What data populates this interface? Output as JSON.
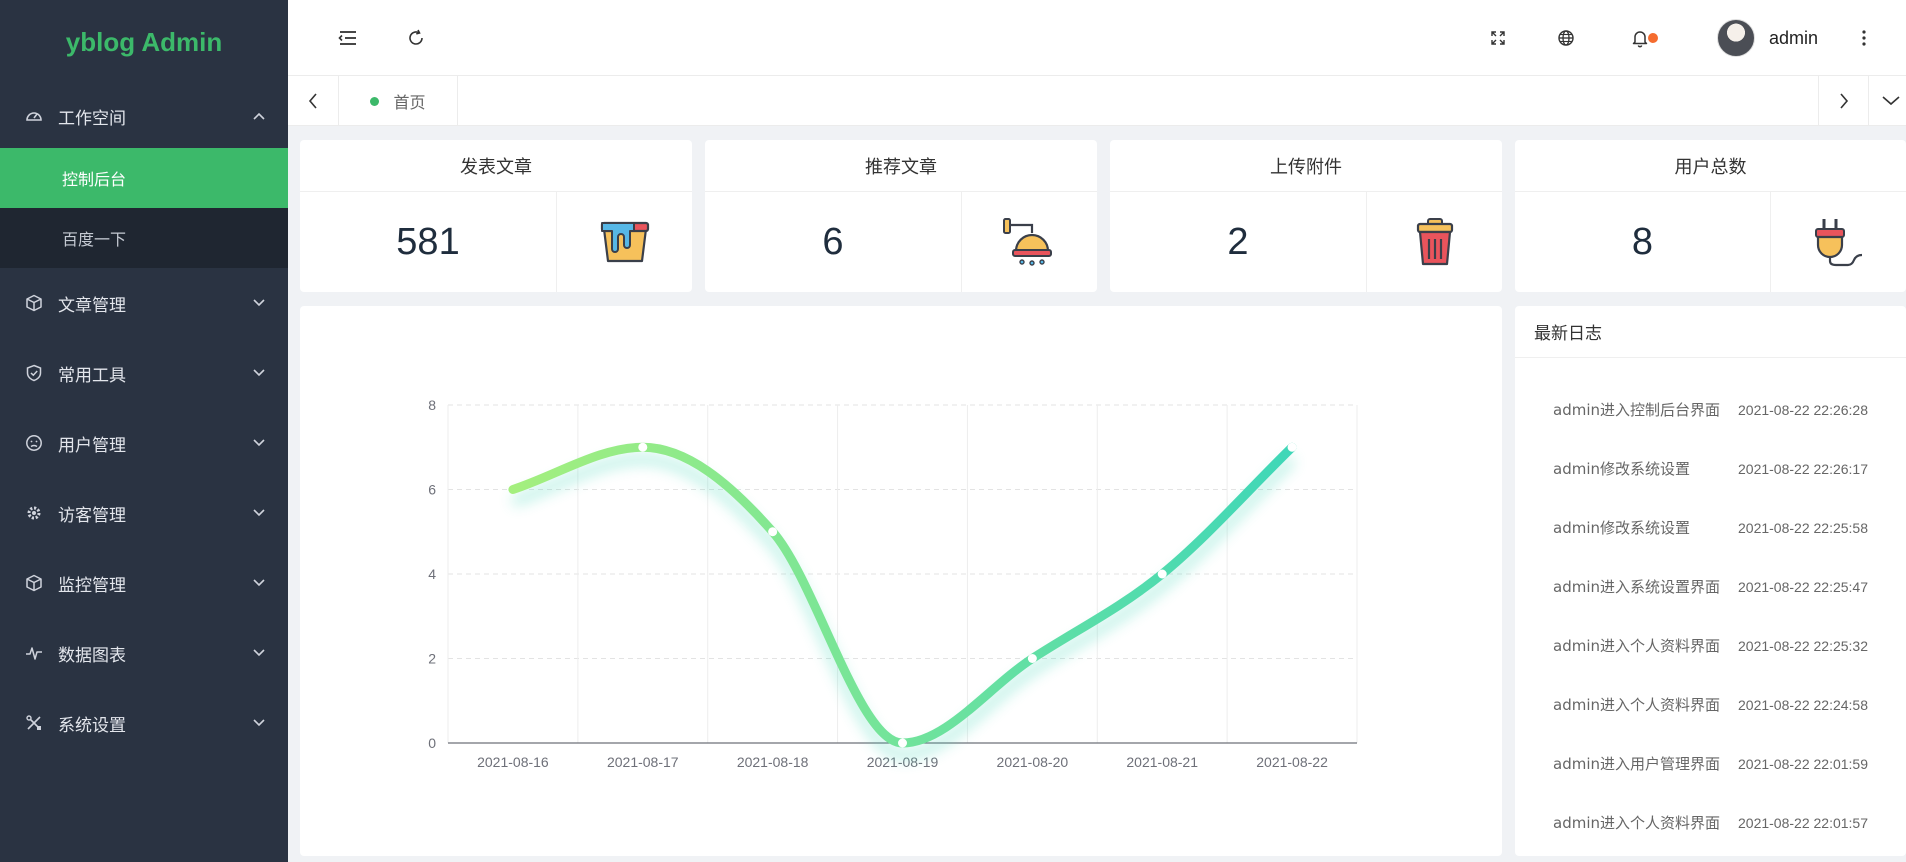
{
  "app": {
    "title": "yblog Admin"
  },
  "sidebar": {
    "workspace": {
      "label": "工作空间",
      "icon": "dashboard-icon",
      "expanded": true,
      "children": [
        {
          "label": "控制后台",
          "active": true
        },
        {
          "label": "百度一下",
          "active": false
        }
      ]
    },
    "items": [
      {
        "label": "文章管理",
        "icon": "cube-icon"
      },
      {
        "label": "常用工具",
        "icon": "shield-check-icon"
      },
      {
        "label": "用户管理",
        "icon": "face-icon"
      },
      {
        "label": "访客管理",
        "icon": "gear-icon"
      },
      {
        "label": "监控管理",
        "icon": "cube-icon"
      },
      {
        "label": "数据图表",
        "icon": "pulse-icon"
      },
      {
        "label": "系统设置",
        "icon": "tools-icon"
      }
    ]
  },
  "topbar": {
    "icons": [
      "collapse-menu-icon",
      "refresh-icon",
      "fullscreen-icon",
      "language-icon",
      "bell-icon",
      "more-vertical-icon"
    ],
    "notification_dot_color": "#f56c2f",
    "user_name": "admin"
  },
  "tabs": [
    {
      "label": "首页",
      "active": true
    }
  ],
  "stats": [
    {
      "title": "发表文章",
      "value": "581",
      "icon": "paint-bucket-icon"
    },
    {
      "title": "推荐文章",
      "value": "6",
      "icon": "shower-icon"
    },
    {
      "title": "上传附件",
      "value": "2",
      "icon": "trash-bin-icon"
    },
    {
      "title": "用户总数",
      "value": "8",
      "icon": "plug-icon"
    }
  ],
  "chart_data": {
    "type": "line",
    "smooth": true,
    "x": [
      "2021-08-16",
      "2021-08-17",
      "2021-08-18",
      "2021-08-19",
      "2021-08-20",
      "2021-08-21",
      "2021-08-22"
    ],
    "series": [
      {
        "values": [
          6,
          7,
          5,
          0,
          2,
          4,
          7
        ]
      }
    ],
    "ylim": [
      0,
      8
    ],
    "yticks": [
      "0",
      "2",
      "4",
      "6",
      "8"
    ],
    "grid": true,
    "line_gradient": [
      "#a4ef7e",
      "#3fd7b8"
    ]
  },
  "log": {
    "title": "最新日志",
    "entries": [
      {
        "text": "admin进入控制后台界面",
        "time": "2021-08-22 22:26:28"
      },
      {
        "text": "admin修改系统设置",
        "time": "2021-08-22 22:26:17"
      },
      {
        "text": "admin修改系统设置",
        "time": "2021-08-22 22:25:58"
      },
      {
        "text": "admin进入系统设置界面",
        "time": "2021-08-22 22:25:47"
      },
      {
        "text": "admin进入个人资料界面",
        "time": "2021-08-22 22:25:32"
      },
      {
        "text": "admin进入个人资料界面",
        "time": "2021-08-22 22:24:58"
      },
      {
        "text": "admin进入用户管理界面",
        "time": "2021-08-22 22:01:59"
      },
      {
        "text": "admin进入个人资料界面",
        "time": "2021-08-22 22:01:57"
      }
    ]
  }
}
